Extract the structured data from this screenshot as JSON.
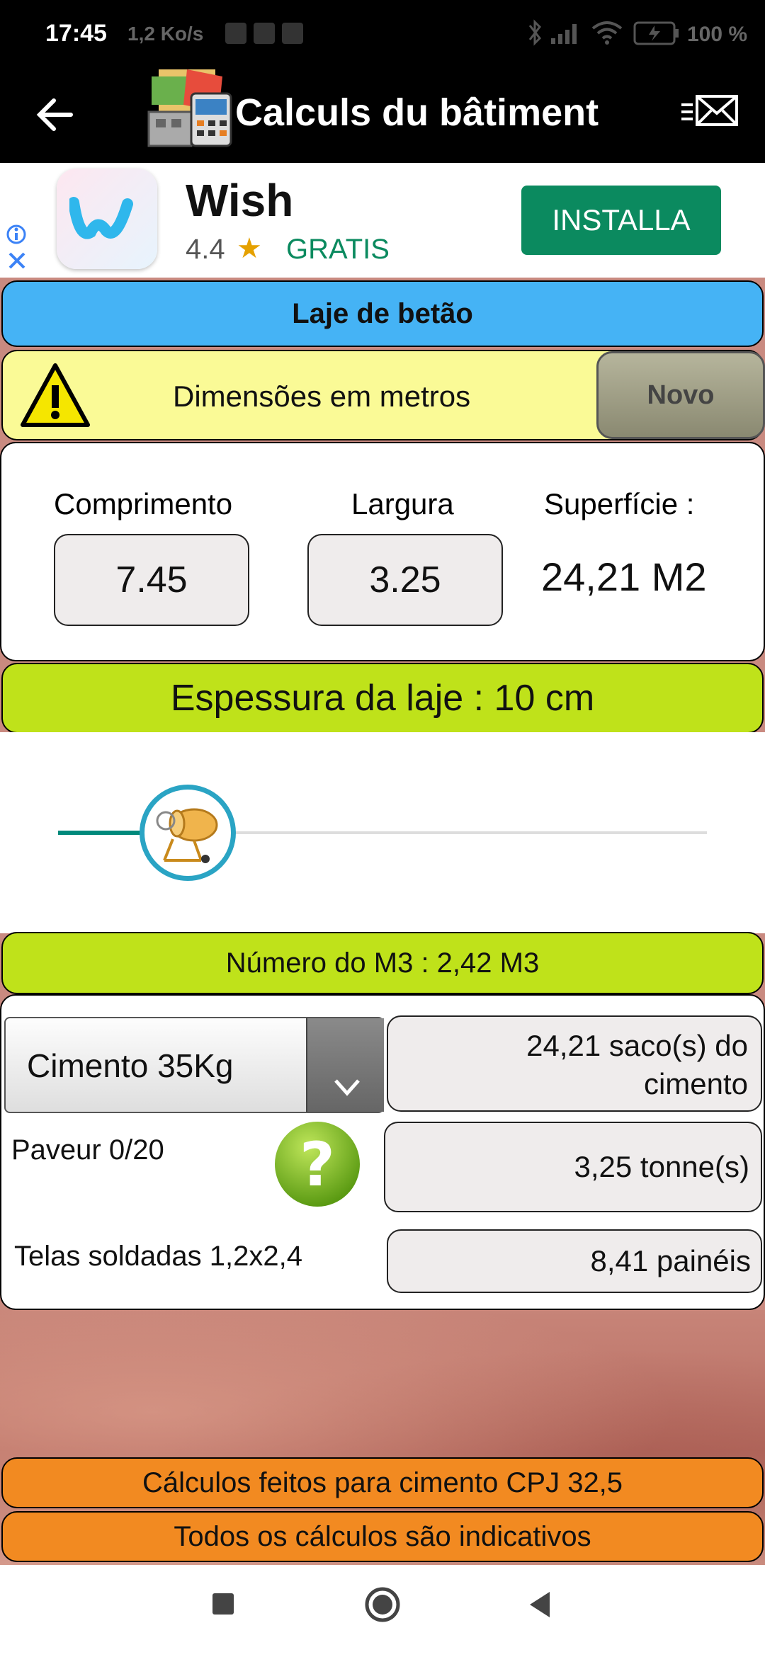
{
  "status_bar": {
    "time": "17:45",
    "net_speed": "1,2 Ko/s",
    "battery_pct": "100 %",
    "icons": [
      "bluetooth-icon",
      "signal-icon",
      "wifi-icon",
      "battery-icon"
    ]
  },
  "app_bar": {
    "title": "Calculs du bâtiment",
    "back_icon": "arrow-left-icon",
    "menu_icon": "menu-mail-icon"
  },
  "ad": {
    "app_name": "Wish",
    "rating": "4.4",
    "star": "★",
    "price": "GRATIS",
    "install_label": "INSTALLA",
    "install_color": "#0b8a5f"
  },
  "header": {
    "title": "Laje de betão",
    "color": "#45b3f5"
  },
  "warning": {
    "text": "Dimensões em metros",
    "new_button": "Novo",
    "bg": "#fafa96"
  },
  "dims": {
    "length_label": "Comprimento",
    "length_value": "7.45",
    "width_label": "Largura",
    "width_value": "3.25",
    "surface_label": "Superfície :",
    "surface_value": "24,21 M2"
  },
  "thickness": {
    "label": "Espessura da laje : 10 cm",
    "slider_fraction": 0.2,
    "accent": "#00897b"
  },
  "volume": {
    "label": "Número do M3 : 2,42 M3",
    "bg": "#bfe21a"
  },
  "materials": {
    "cement_select": "Cimento 35Kg",
    "cement_result_line1": "24,21 saco(s) do",
    "cement_result_line2": "cimento",
    "paver_label": "Paveur 0/20",
    "paver_result": "3,25 tonne(s)",
    "mesh_label": "Telas soldadas 1,2x2,4",
    "mesh_result": "8,41 painéis"
  },
  "footer": {
    "line1": "Cálculos feitos para cimento CPJ 32,5",
    "line2": "Todos os cálculos são indicativos",
    "bg": "#f28a21"
  }
}
